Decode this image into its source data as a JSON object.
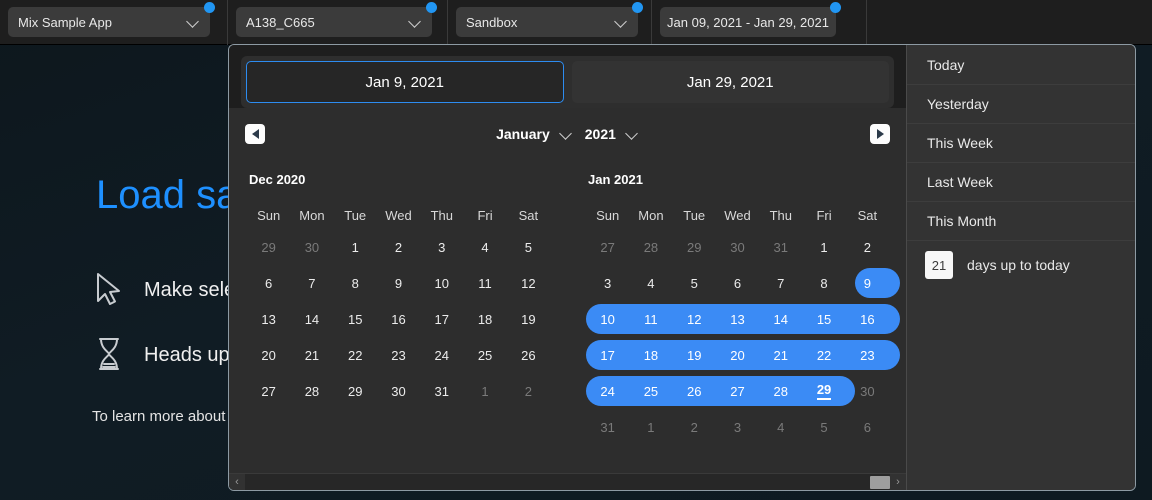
{
  "topbar": {
    "filters": [
      {
        "label": "Mix Sample App",
        "icon": "chevron-down-icon",
        "dot": true
      },
      {
        "label": "A138_C665",
        "icon": "chevron-down-icon",
        "dot": true
      },
      {
        "label": "Sandbox",
        "icon": "chevron-down-icon",
        "dot": true
      },
      {
        "label": "Jan 09, 2021 - Jan 29, 2021",
        "icon": "",
        "dot": true
      }
    ]
  },
  "background": {
    "title": "Load sa",
    "row1": "Make sele",
    "row2": "Heads up",
    "note": "To learn more about"
  },
  "picker": {
    "tabs": [
      {
        "label": "Jan 9, 2021",
        "active": true
      },
      {
        "label": "Jan 29, 2021",
        "active": false
      }
    ],
    "nav": {
      "prev": "prev-month-arrow",
      "next": "next-month-arrow",
      "month": "January",
      "year": "2021"
    },
    "weekdays": [
      "Sun",
      "Mon",
      "Tue",
      "Wed",
      "Thu",
      "Fri",
      "Sat"
    ],
    "calendars": [
      {
        "title": "Dec 2020",
        "weeks": [
          [
            {
              "d": "29",
              "muted": true
            },
            {
              "d": "30",
              "muted": true
            },
            {
              "d": "1"
            },
            {
              "d": "2"
            },
            {
              "d": "3"
            },
            {
              "d": "4"
            },
            {
              "d": "5"
            }
          ],
          [
            {
              "d": "6"
            },
            {
              "d": "7"
            },
            {
              "d": "8"
            },
            {
              "d": "9"
            },
            {
              "d": "10"
            },
            {
              "d": "11"
            },
            {
              "d": "12"
            }
          ],
          [
            {
              "d": "13"
            },
            {
              "d": "14"
            },
            {
              "d": "15"
            },
            {
              "d": "16"
            },
            {
              "d": "17"
            },
            {
              "d": "18"
            },
            {
              "d": "19"
            }
          ],
          [
            {
              "d": "20"
            },
            {
              "d": "21"
            },
            {
              "d": "22"
            },
            {
              "d": "23"
            },
            {
              "d": "24"
            },
            {
              "d": "25"
            },
            {
              "d": "26"
            }
          ],
          [
            {
              "d": "27"
            },
            {
              "d": "28"
            },
            {
              "d": "29"
            },
            {
              "d": "30"
            },
            {
              "d": "31"
            },
            {
              "d": "1",
              "muted": true
            },
            {
              "d": "2",
              "muted": true
            }
          ]
        ],
        "range_bars": []
      },
      {
        "title": "Jan 2021",
        "weeks": [
          [
            {
              "d": "27",
              "muted": true
            },
            {
              "d": "28",
              "muted": true
            },
            {
              "d": "29",
              "muted": true
            },
            {
              "d": "30",
              "muted": true
            },
            {
              "d": "31",
              "muted": true
            },
            {
              "d": "1"
            },
            {
              "d": "2"
            }
          ],
          [
            {
              "d": "3"
            },
            {
              "d": "4"
            },
            {
              "d": "5"
            },
            {
              "d": "6"
            },
            {
              "d": "7"
            },
            {
              "d": "8"
            },
            {
              "d": "9",
              "inRange": true
            }
          ],
          [
            {
              "d": "10",
              "inRange": true
            },
            {
              "d": "11",
              "inRange": true
            },
            {
              "d": "12",
              "inRange": true
            },
            {
              "d": "13",
              "inRange": true
            },
            {
              "d": "14",
              "inRange": true
            },
            {
              "d": "15",
              "inRange": true
            },
            {
              "d": "16",
              "inRange": true
            }
          ],
          [
            {
              "d": "17",
              "inRange": true
            },
            {
              "d": "18",
              "inRange": true
            },
            {
              "d": "19",
              "inRange": true
            },
            {
              "d": "20",
              "inRange": true
            },
            {
              "d": "21",
              "inRange": true
            },
            {
              "d": "22",
              "inRange": true
            },
            {
              "d": "23",
              "inRange": true
            }
          ],
          [
            {
              "d": "24",
              "inRange": true
            },
            {
              "d": "25",
              "inRange": true
            },
            {
              "d": "26",
              "inRange": true
            },
            {
              "d": "27",
              "inRange": true
            },
            {
              "d": "28",
              "inRange": true
            },
            {
              "d": "29",
              "inRange": true,
              "endpoint": true
            },
            {
              "d": "30",
              "muted": true
            }
          ],
          [
            {
              "d": "31",
              "muted": true
            },
            {
              "d": "1",
              "muted": true
            },
            {
              "d": "2",
              "muted": true
            },
            {
              "d": "3",
              "muted": true
            },
            {
              "d": "4",
              "muted": true
            },
            {
              "d": "5",
              "muted": true
            },
            {
              "d": "6",
              "muted": true
            }
          ]
        ],
        "range_bars": [
          {
            "row": 1,
            "startCol": 6,
            "endCol": 6,
            "roundLeft": true,
            "roundRight": true
          },
          {
            "row": 2,
            "startCol": 0,
            "endCol": 6,
            "roundLeft": true,
            "roundRight": true
          },
          {
            "row": 3,
            "startCol": 0,
            "endCol": 6,
            "roundLeft": true,
            "roundRight": true
          },
          {
            "row": 4,
            "startCol": 0,
            "endCol": 5,
            "roundLeft": true,
            "roundRight": true
          }
        ]
      }
    ],
    "scrollbar": {
      "left_arrow": "‹",
      "right_arrow": "›"
    }
  },
  "shortcuts": {
    "items": [
      "Today",
      "Yesterday",
      "This Week",
      "Last Week",
      "This Month"
    ],
    "days_value": "21",
    "days_label": "days up to today"
  },
  "colors": {
    "accent_blue": "#3b8bf5",
    "focus_blue": "#2d8cf0",
    "dot_blue": "#2196f3",
    "title_blue": "#1e90ff",
    "panel_bg": "#2d2d2d",
    "sidebar_bg": "#333333"
  }
}
